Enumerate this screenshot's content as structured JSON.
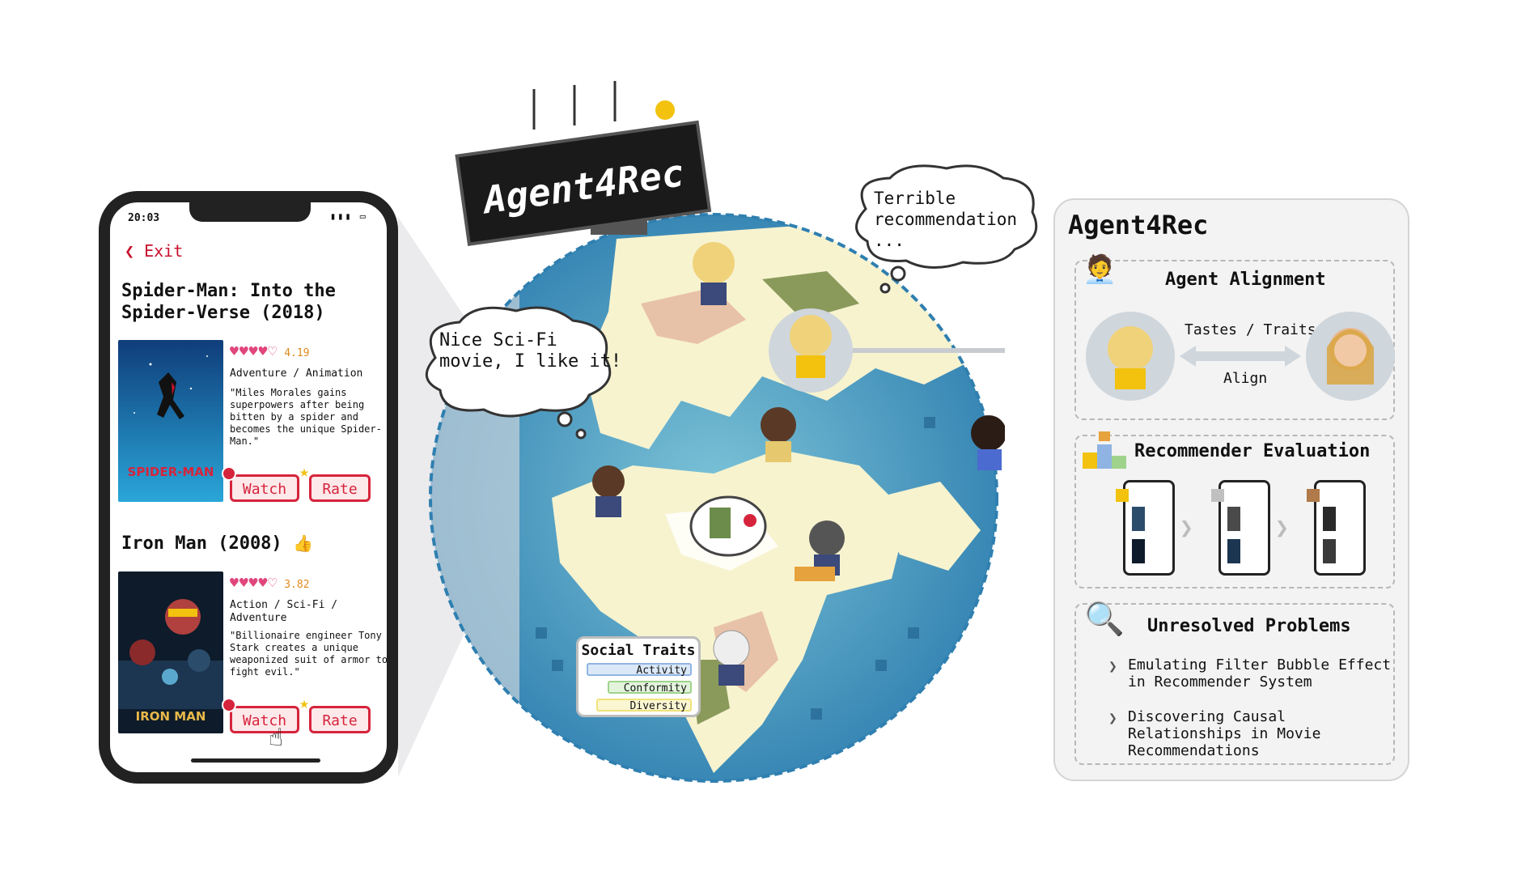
{
  "phone": {
    "status_time": "20:03",
    "status_icons": "▮▮▮ ▭",
    "exit_label": "Exit",
    "movies": [
      {
        "title": "Spider-Man: Into the Spider-Verse (2018)",
        "hearts": "♥♥♥♥♡",
        "rating": "4.19",
        "genre": "Adventure / Animation",
        "description": "\"Miles Morales gains superpowers after being bitten by a spider and becomes the unique Spider-Man.\"",
        "poster_text": "SPIDER-MAN",
        "watch_label": "Watch",
        "rate_label": "Rate"
      },
      {
        "title": "Iron Man (2008)",
        "hearts": "♥♥♥♥♡",
        "rating": "3.82",
        "genre": "Action / Sci-Fi / Adventure",
        "description": "\"Billionaire engineer Tony Stark creates a unique weaponized suit of armor to fight evil.\"",
        "poster_text": "IRON MAN",
        "watch_label": "Watch",
        "rate_label": "Rate"
      }
    ]
  },
  "sign": {
    "text": "Agent4Rec"
  },
  "bubbles": {
    "left": "Nice Sci-Fi\nmovie, I like it!",
    "right": "Terrible\nrecommendation\n..."
  },
  "social_traits": {
    "title": "Social Traits",
    "items": [
      {
        "label": "Activity",
        "color": "#8fb4e3"
      },
      {
        "label": "Conformity",
        "color": "#9fd38c"
      },
      {
        "label": "Diversity",
        "color": "#f1e27a"
      }
    ]
  },
  "right_panel": {
    "title": "Agent4Rec",
    "alignment": {
      "title": "Agent Alignment",
      "tastes_label": "Tastes / Traits",
      "align_label": "Align"
    },
    "evaluation": {
      "title": "Recommender Evaluation",
      "podium": "2 1 3"
    },
    "problems": {
      "title": "Unresolved Problems",
      "items": [
        "Emulating Filter Bubble Effect in Recommender System",
        "Discovering Causal Relationships in Movie Recommendations"
      ]
    }
  },
  "colors": {
    "ocean": "#2f7fb0",
    "ocean_light": "#7dc4d8",
    "land": "#f7f3cf",
    "desert": "#e8c2a8",
    "forest": "#8a9a5b",
    "accent_red": "#d6243c",
    "heart_pink": "#e0457b"
  }
}
